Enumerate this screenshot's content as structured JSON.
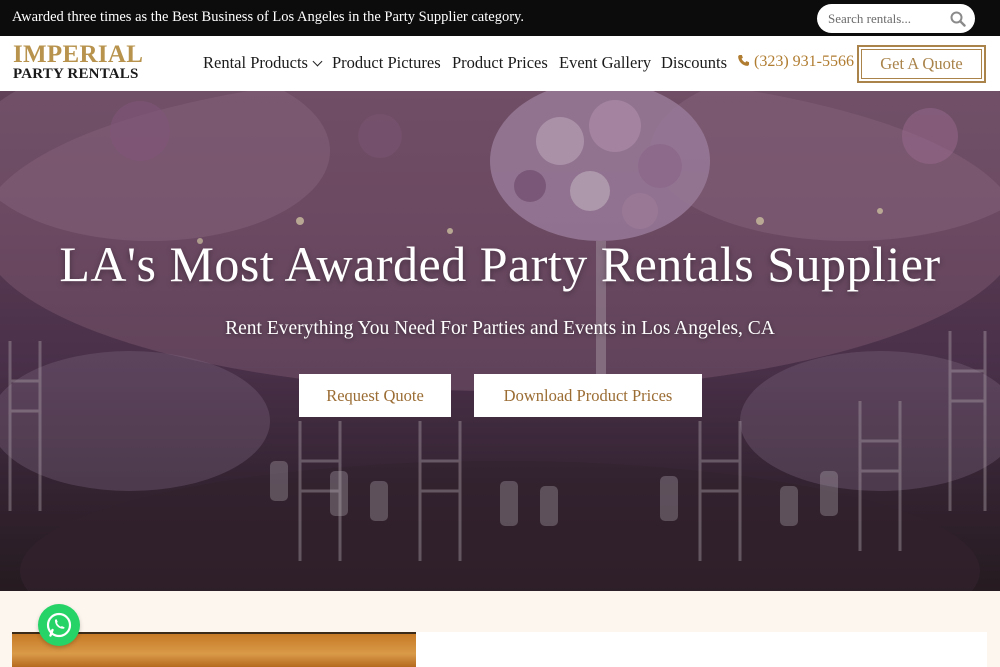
{
  "topbar": {
    "award_text": "Awarded three times as the Best Business of Los Angeles in the Party Supplier category.",
    "search_placeholder": "Search rentals..."
  },
  "brand": {
    "name_line1": "IMPERIAL",
    "name_line2": "PARTY RENTALS",
    "gold": "#b8934e"
  },
  "nav": {
    "items": [
      {
        "label": "Rental Products",
        "has_dropdown": true
      },
      {
        "label": "Product Pictures"
      },
      {
        "label": "Product Prices"
      },
      {
        "label": "Event Gallery"
      },
      {
        "label": "Discounts"
      }
    ],
    "phone": "(323) 931-5566",
    "quote_label": "Get A Quote"
  },
  "hero": {
    "title": "LA's Most Awarded Party Rentals Supplier",
    "subtitle": "Rent Everything You Need For Parties and Events in Los Angeles, CA",
    "primary_button": "Request Quote",
    "secondary_button": "Download Product Prices"
  },
  "icons": {
    "search": "search-icon",
    "phone": "phone-icon",
    "chevron": "chevron-down-icon",
    "whatsapp": "whatsapp-icon"
  },
  "colors": {
    "accent": "#a9834a",
    "topbar_bg": "#0c0c0c",
    "whatsapp": "#25d366",
    "section_bg": "#fdf6ee"
  }
}
